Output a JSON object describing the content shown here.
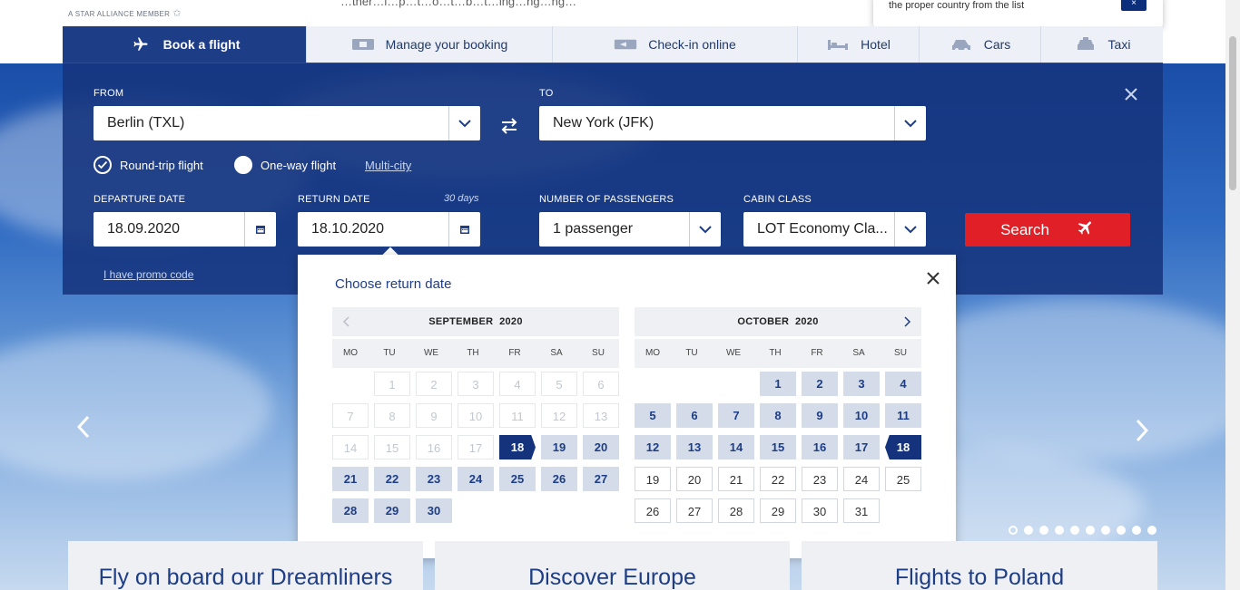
{
  "header": {
    "alliance_text": "A STAR ALLIANCE MEMBER",
    "top_text": "…ther…l…p…t…o…t…b…t…ing…ng…ng…",
    "country_popup_msg": "the proper country from the list",
    "country_popup_btn": "×"
  },
  "tabs": [
    {
      "label": "Book a flight",
      "icon": "plane-icon",
      "active": true
    },
    {
      "label": "Manage your booking",
      "icon": "ticket-icon"
    },
    {
      "label": "Check-in online",
      "icon": "boarding-pass-icon"
    },
    {
      "label": "Hotel",
      "icon": "bed-icon"
    },
    {
      "label": "Cars",
      "icon": "car-icon"
    },
    {
      "label": "Taxi",
      "icon": "taxi-icon"
    }
  ],
  "form": {
    "from_label": "FROM",
    "from_value": "Berlin (TXL)",
    "to_label": "TO",
    "to_value": "New York (JFK)",
    "round_trip": "Round-trip flight",
    "one_way": "One-way flight",
    "multi_city": "Multi-city",
    "departure_label": "DEPARTURE DATE",
    "departure_value": "18.09.2020",
    "return_label": "RETURN DATE",
    "return_value": "18.10.2020",
    "days_note": "30 days",
    "passengers_label": "NUMBER OF PASSENGERS",
    "passengers_value": "1 passenger",
    "cabin_label": "CABIN CLASS",
    "cabin_value": "LOT Economy Cla...",
    "search_label": "Search",
    "promo": "I have promo code"
  },
  "calendar": {
    "title": "Choose return date",
    "weekdays": [
      "MO",
      "TU",
      "WE",
      "TH",
      "FR",
      "SA",
      "SU"
    ],
    "months": [
      {
        "name": "SEPTEMBER",
        "year": "2020",
        "offset": 1,
        "days": 30,
        "disabled_until": 17,
        "selected": 18,
        "selected_role": "start",
        "range_from": 19,
        "range_to": 30
      },
      {
        "name": "OCTOBER",
        "year": "2020",
        "offset": 3,
        "days": 31,
        "disabled_until": 0,
        "selected": 18,
        "selected_role": "end",
        "range_from": 1,
        "range_to": 17
      }
    ]
  },
  "carousel": {
    "dots": 10,
    "active_dot": 0
  },
  "cards": [
    {
      "title": "Fly on board our Dreamliners"
    },
    {
      "title": "Discover Europe"
    },
    {
      "title": "Flights to Poland"
    }
  ]
}
